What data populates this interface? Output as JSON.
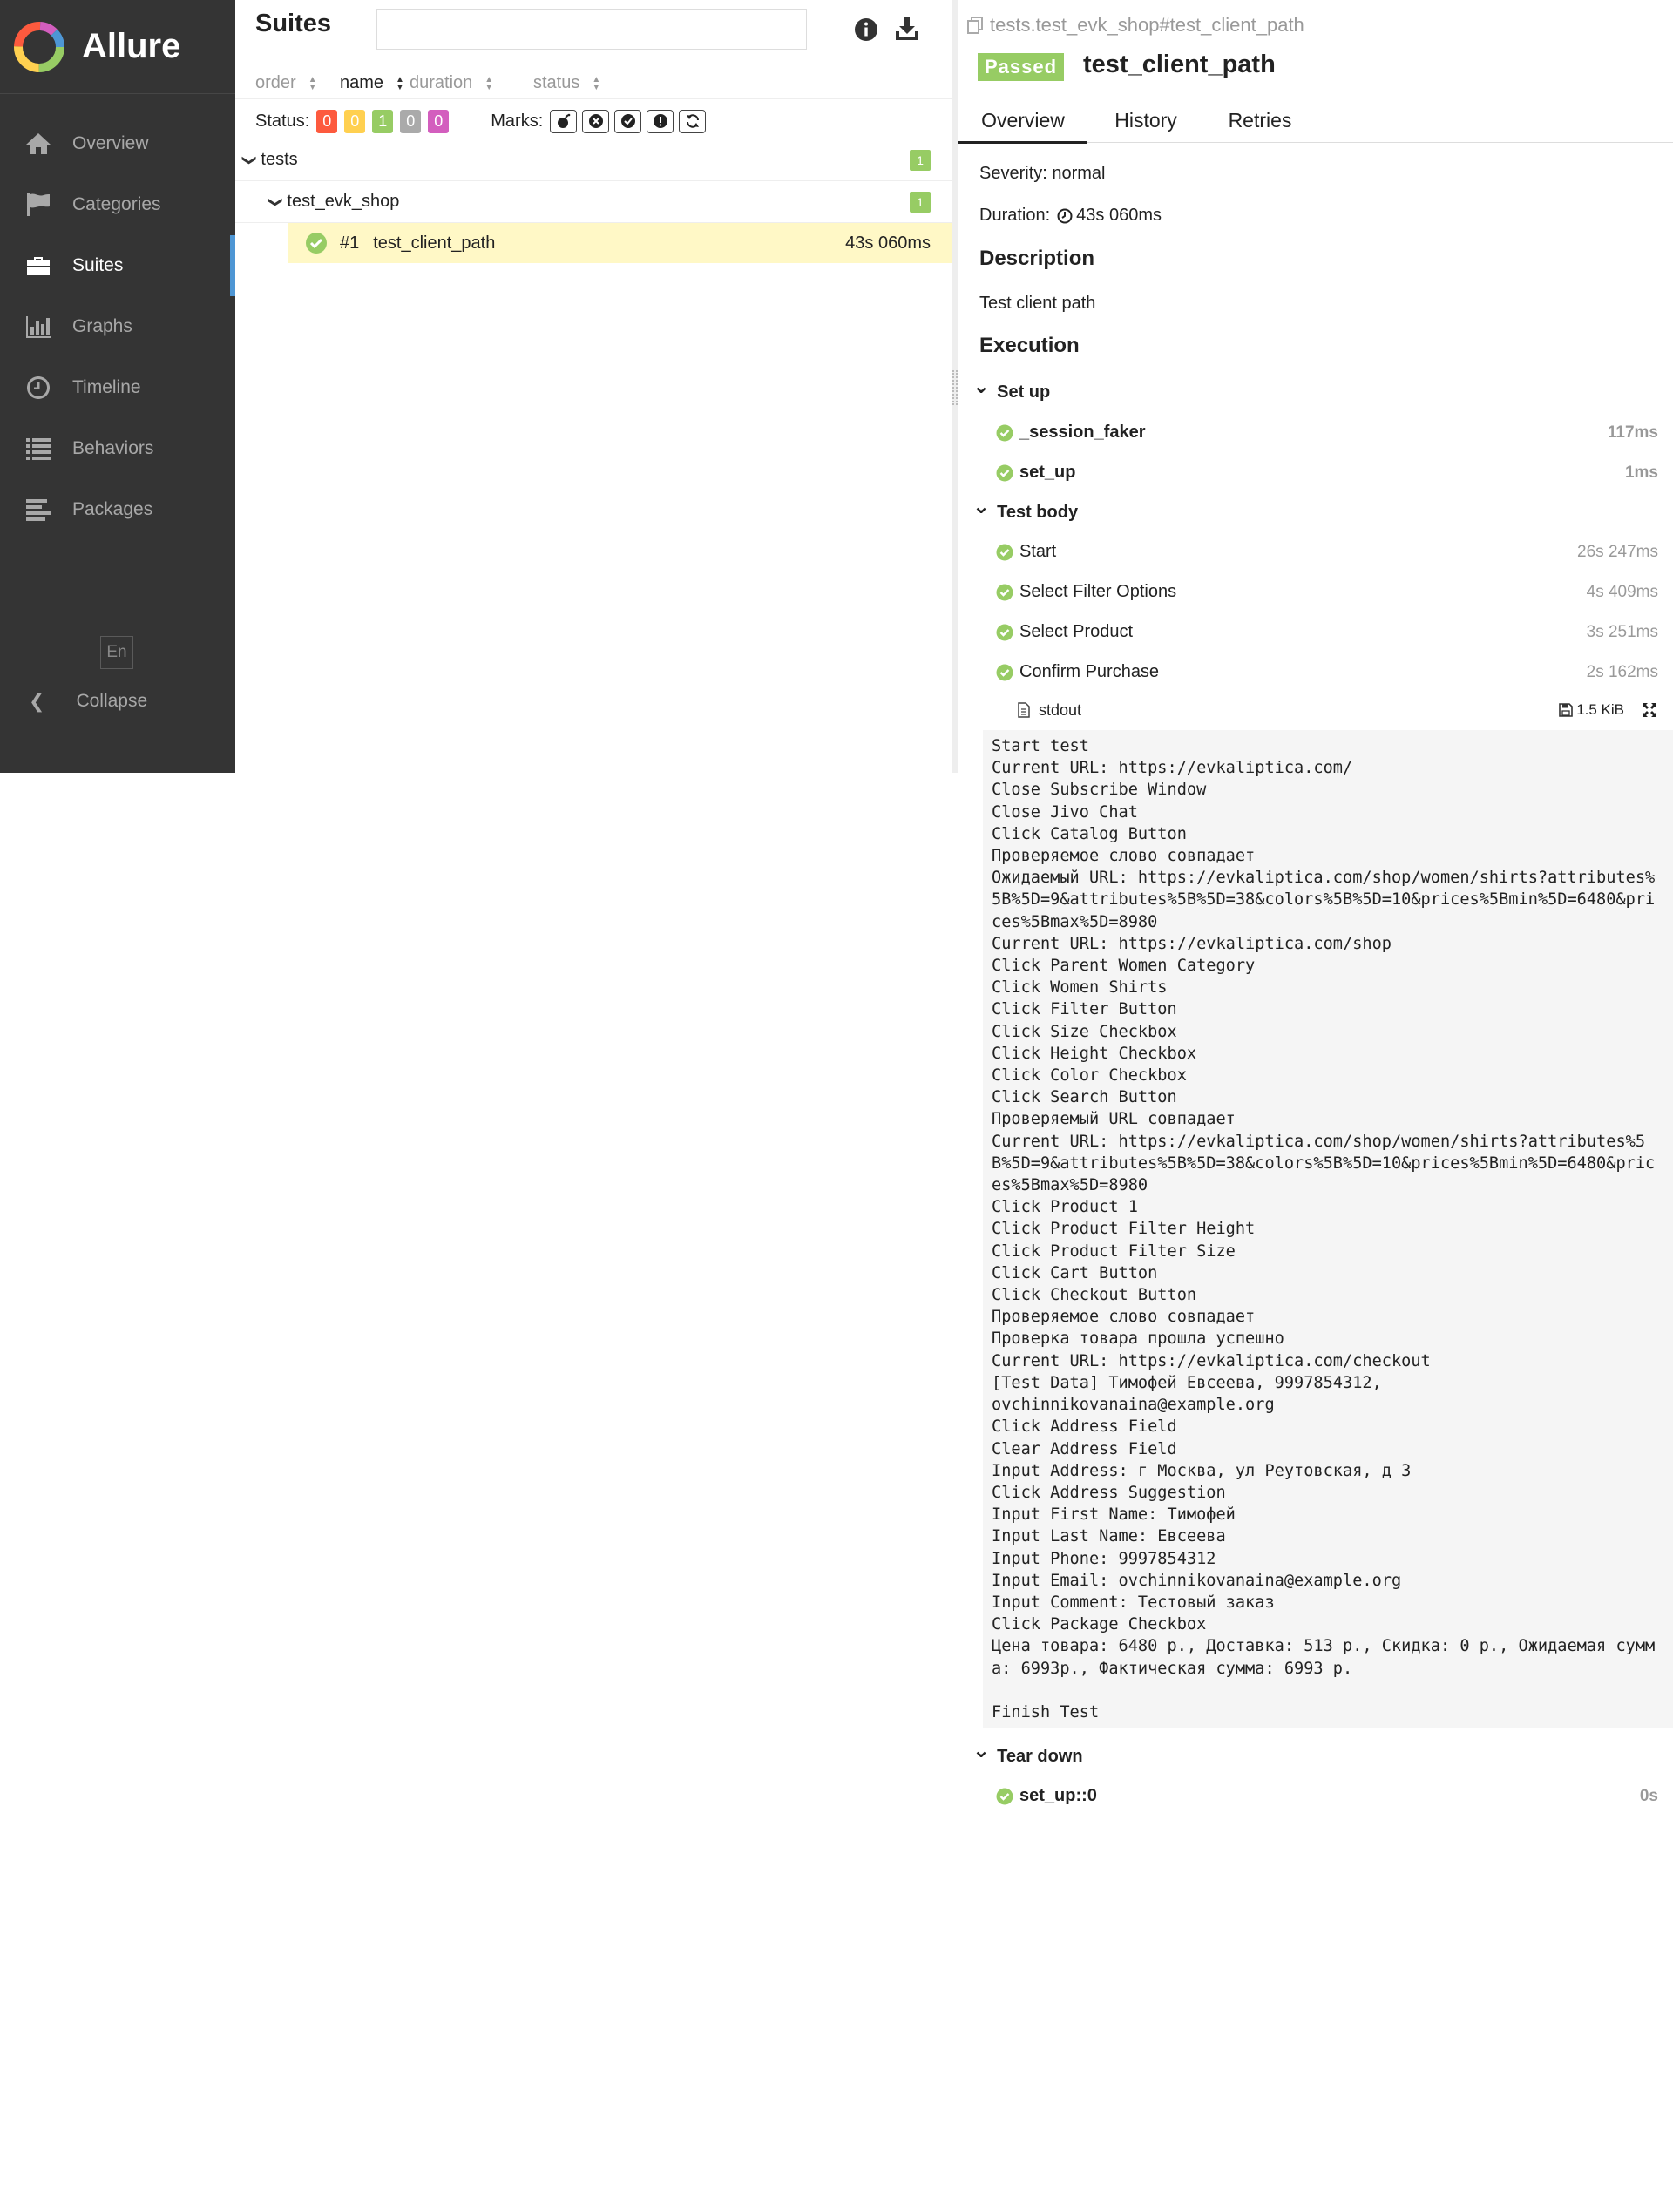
{
  "app": {
    "brand": "Allure"
  },
  "sidebar": {
    "items": [
      {
        "label": "Overview",
        "icon": "home-icon"
      },
      {
        "label": "Categories",
        "icon": "flag-icon"
      },
      {
        "label": "Suites",
        "icon": "briefcase-icon",
        "active": true
      },
      {
        "label": "Graphs",
        "icon": "bar-chart-icon"
      },
      {
        "label": "Timeline",
        "icon": "clock-icon"
      },
      {
        "label": "Behaviors",
        "icon": "list-icon"
      },
      {
        "label": "Packages",
        "icon": "align-left-icon"
      }
    ],
    "language": "En",
    "collapse_label": "Collapse"
  },
  "suites": {
    "title": "Suites",
    "search_value": "",
    "sort": {
      "order": "order",
      "name": "name",
      "duration": "duration",
      "status": "status"
    },
    "status_label": "Status:",
    "status_counts": [
      {
        "value": "0",
        "color": "#fd5a3e"
      },
      {
        "value": "0",
        "color": "#ffd050"
      },
      {
        "value": "1",
        "color": "#97cc64"
      },
      {
        "value": "0",
        "color": "#aaaaaa"
      },
      {
        "value": "0",
        "color": "#d35ebe"
      }
    ],
    "marks_label": "Marks:",
    "marks": [
      "flaky-icon",
      "new-failed-icon",
      "new-passed-icon",
      "new-broken-icon",
      "retries-status-change-icon"
    ],
    "tree": {
      "root": {
        "name": "tests",
        "count": "1"
      },
      "child": {
        "name": "test_evk_shop",
        "count": "1"
      },
      "leaf": {
        "index": "#1",
        "name": "test_client_path",
        "duration": "43s 060ms"
      }
    }
  },
  "result": {
    "breadcrumb": "tests.test_evk_shop#test_client_path",
    "status_badge": "Passed",
    "test_name": "test_client_path",
    "tabs": [
      "Overview",
      "History",
      "Retries"
    ],
    "severity": "Severity: normal",
    "duration_label": "Duration:",
    "duration_value": "43s 060ms",
    "description_heading": "Description",
    "description_text": "Test client path",
    "execution_heading": "Execution",
    "setup": {
      "label": "Set up",
      "steps": [
        {
          "name": "_session_faker",
          "duration": "117ms"
        },
        {
          "name": "set_up",
          "duration": "1ms"
        }
      ]
    },
    "body": {
      "label": "Test body",
      "steps": [
        {
          "name": "Start",
          "duration": "26s 247ms"
        },
        {
          "name": "Select Filter Options",
          "duration": "4s 409ms"
        },
        {
          "name": "Select Product",
          "duration": "3s 251ms"
        },
        {
          "name": "Confirm Purchase",
          "duration": "2s 162ms"
        }
      ]
    },
    "attachment": {
      "name": "stdout",
      "size": "1.5 KiB"
    },
    "stdout": "Start test\nCurrent URL: https://evkaliptica.com/\nClose Subscribe Window\nClose Jivo Chat\nClick Catalog Button\nПроверяемое слово совпадает\nОжидаемый URL: https://evkaliptica.com/shop/women/shirts?attributes%5B%5D=9&attributes%5B%5D=38&colors%5B%5D=10&prices%5Bmin%5D=6480&prices%5Bmax%5D=8980\nCurrent URL: https://evkaliptica.com/shop\nClick Parent Women Category\nClick Women Shirts\nClick Filter Button\nClick Size Checkbox\nClick Height Checkbox\nClick Color Checkbox\nClick Search Button\nПроверяемый URL совпадает\nCurrent URL: https://evkaliptica.com/shop/women/shirts?attributes%5B%5D=9&attributes%5B%5D=38&colors%5B%5D=10&prices%5Bmin%5D=6480&prices%5Bmax%5D=8980\nClick Product 1\nClick Product Filter Height\nClick Product Filter Size\nClick Cart Button\nClick Checkout Button\nПроверяемое слово совпадает\nПроверка товара прошла успешно\nCurrent URL: https://evkaliptica.com/checkout\n[Test Data] Тимофей Евсеева, 9997854312,\novchinnikovanaina@example.org\nClick Address Field\nClear Address Field\nInput Address: г Москва, ул Реутовская, д 3\nClick Address Suggestion\nInput First Name: Тимофей\nInput Last Name: Евсеева\nInput Phone: 9997854312\nInput Email: ovchinnikovanaina@example.org\nInput Comment: Тестовый заказ\nClick Package Checkbox\nЦена товара: 6480 р., Доставка: 513 р., Скидка: 0 р., Ожидаемая сумма: 6993р., Фактическая сумма: 6993 р.\n\nFinish Test",
    "teardown": {
      "label": "Tear down",
      "steps": [
        {
          "name": "set_up::0",
          "duration": "0s"
        }
      ]
    }
  },
  "colors": {
    "sidebar_bg": "#343434",
    "passed": "#97cc64",
    "active_accent": "#4e96d4",
    "selected_row": "#fff8c6"
  }
}
